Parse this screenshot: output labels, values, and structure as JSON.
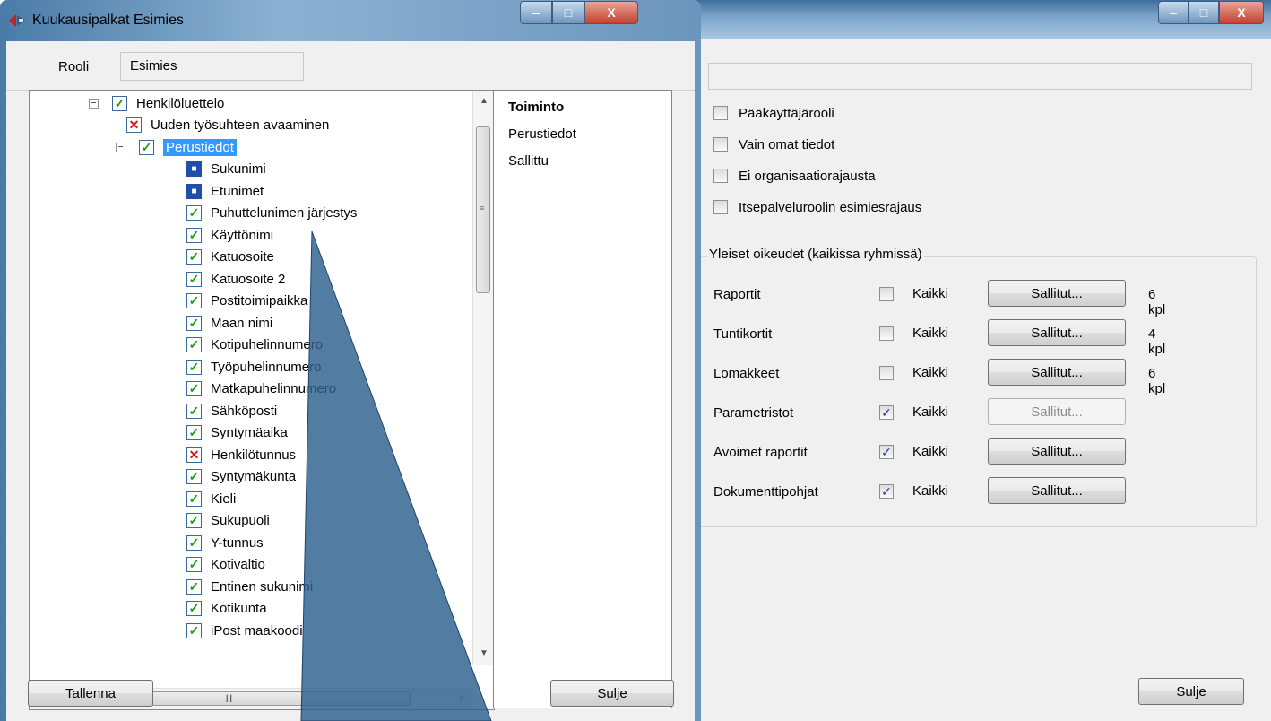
{
  "back_window": {
    "window_buttons": {
      "minimize": "–",
      "maximize": "□",
      "close": "X"
    },
    "options": [
      {
        "label": "Pääkäyttäjärooli",
        "checked": false
      },
      {
        "label": "Vain omat tiedot",
        "checked": false
      },
      {
        "label": "Ei organisaatiorajausta",
        "checked": false
      },
      {
        "label": "Itsepalveluroolin esimiesrajaus",
        "checked": false
      }
    ],
    "group_title": "Yleiset oikeudet (kaikissa ryhmissä)",
    "permissions": [
      {
        "label": "Raportit",
        "all_label": "Kaikki",
        "all_checked": false,
        "button": "Sallitut...",
        "button_enabled": true,
        "count": "6 kpl"
      },
      {
        "label": "Tuntikortit",
        "all_label": "Kaikki",
        "all_checked": false,
        "button": "Sallitut...",
        "button_enabled": true,
        "count": "4 kpl"
      },
      {
        "label": "Lomakkeet",
        "all_label": "Kaikki",
        "all_checked": false,
        "button": "Sallitut...",
        "button_enabled": true,
        "count": "6 kpl"
      },
      {
        "label": "Parametristot",
        "all_label": "Kaikki",
        "all_checked": true,
        "button": "Sallitut...",
        "button_enabled": false,
        "count": ""
      },
      {
        "label": "Avoimet raportit",
        "all_label": "Kaikki",
        "all_checked": true,
        "button": "Sallitut...",
        "button_enabled": true,
        "count": ""
      },
      {
        "label": "Dokumenttipohjat",
        "all_label": "Kaikki",
        "all_checked": true,
        "button": "Sallitut...",
        "button_enabled": true,
        "count": ""
      }
    ],
    "close_button": "Sulje"
  },
  "dialog": {
    "title": "Kuukausipalkat Esimies",
    "window_buttons": {
      "minimize": "–",
      "maximize": "□",
      "close": "X"
    },
    "role_label": "Rooli",
    "role_value": "Esimies",
    "tree": [
      {
        "label": "Henkilöluettelo",
        "state": "ok",
        "level": 0,
        "expander": "−"
      },
      {
        "label": "Uuden työsuhteen avaaminen",
        "state": "no",
        "level": 1,
        "expander": ""
      },
      {
        "label": "Perustiedot",
        "state": "ok",
        "level": 1,
        "expander": "−",
        "selected": true
      },
      {
        "label": "Sukunimi",
        "state": "lock",
        "level": 2
      },
      {
        "label": "Etunimet",
        "state": "lock",
        "level": 2
      },
      {
        "label": "Puhuttelunimen järjestys",
        "state": "ok",
        "level": 2
      },
      {
        "label": "Käyttönimi",
        "state": "ok",
        "level": 2
      },
      {
        "label": "Katuosoite",
        "state": "ok",
        "level": 2
      },
      {
        "label": "Katuosoite 2",
        "state": "ok",
        "level": 2
      },
      {
        "label": "Postitoimipaikka",
        "state": "ok",
        "level": 2
      },
      {
        "label": "Maan nimi",
        "state": "ok",
        "level": 2
      },
      {
        "label": "Kotipuhelinnumero",
        "state": "ok",
        "level": 2
      },
      {
        "label": "Työpuhelinnumero",
        "state": "ok",
        "level": 2
      },
      {
        "label": "Matkapuhelinnumero",
        "state": "ok",
        "level": 2
      },
      {
        "label": "Sähköposti",
        "state": "ok",
        "level": 2
      },
      {
        "label": "Syntymäaika",
        "state": "ok",
        "level": 2
      },
      {
        "label": "Henkilötunnus",
        "state": "no",
        "level": 2
      },
      {
        "label": "Syntymäkunta",
        "state": "ok",
        "level": 2
      },
      {
        "label": "Kieli",
        "state": "ok",
        "level": 2
      },
      {
        "label": "Sukupuoli",
        "state": "ok",
        "level": 2
      },
      {
        "label": "Y-tunnus",
        "state": "ok",
        "level": 2
      },
      {
        "label": "Kotivaltio",
        "state": "ok",
        "level": 2
      },
      {
        "label": "Entinen sukunimi",
        "state": "ok",
        "level": 2
      },
      {
        "label": "Kotikunta",
        "state": "ok",
        "level": 2
      },
      {
        "label": "iPost maakoodi",
        "state": "ok",
        "level": 2
      }
    ],
    "detail": {
      "heading": "Toiminto",
      "lines": [
        "Perustiedot",
        "Sallittu"
      ]
    },
    "save_button": "Tallenna",
    "close_button": "Sulje"
  }
}
